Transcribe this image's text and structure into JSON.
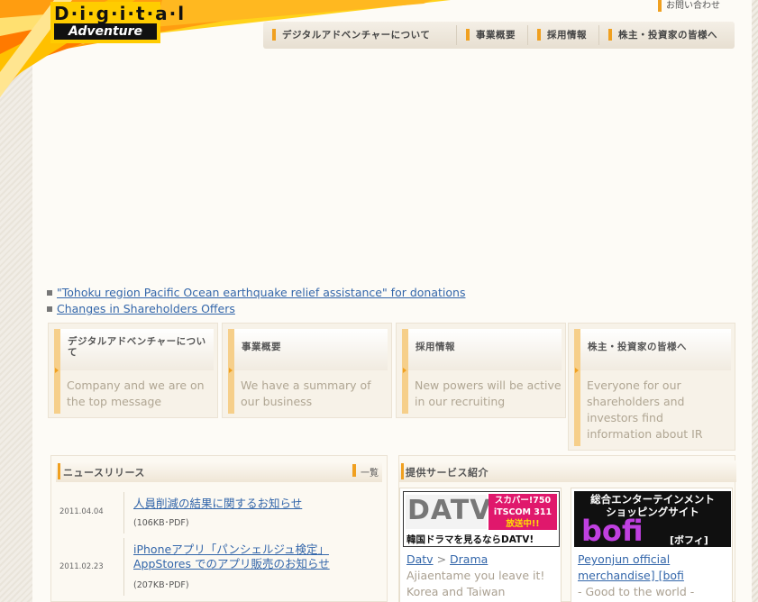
{
  "header": {
    "logo_line1": "D·i·g·i·t·a·l",
    "logo_line2": "Adventure",
    "contact_label": "お問い合わせ",
    "nav": [
      {
        "label": "デジタルアドベンチャーについて"
      },
      {
        "label": "事業概要"
      },
      {
        "label": "採用情報"
      },
      {
        "label": "株主・投資家の皆様へ"
      }
    ]
  },
  "notices": [
    "\"Tohoku region Pacific Ocean earthquake relief assistance\" for donations",
    "Changes in Shareholders Offers"
  ],
  "cards": [
    {
      "title": "デジタルアドベンチャーについて",
      "body": "Company and we are on the top message"
    },
    {
      "title": "事業概要",
      "body": "We have a summary of our business"
    },
    {
      "title": "採用情報",
      "body": "New powers will be active in our recruiting"
    },
    {
      "title": "株主・投資家の皆様へ",
      "body": "Everyone for our shareholders and investors find information about IR"
    }
  ],
  "news": {
    "heading": "ニュースリリース",
    "more_label": "一覧",
    "items": [
      {
        "date": "2011.04.04",
        "title": "人員削減の結果に関するお知らせ",
        "meta": "(106KB･PDF)"
      },
      {
        "date": "2011.02.23",
        "title": "iPhoneアプリ「パンシェルジュ検定」AppStores でのアプリ販売のお知らせ",
        "meta": "(207KB･PDF)"
      }
    ]
  },
  "services": {
    "heading": "提供サービス紹介",
    "items": [
      {
        "banner_logo": "DATV",
        "banner_badge_1": "スカパー!750",
        "banner_badge_2": "iTSCOM 311",
        "banner_badge_3": "放送中!!",
        "banner_caption": "韓国ドラマを見るならDATV!",
        "link_1": "Datv",
        "link_sep": ">",
        "link_2": "Drama",
        "desc": "Ajiaentame you leave it! Korea and Taiwan"
      },
      {
        "banner_line1": "総合エンターテインメント",
        "banner_line2": "ショッピングサイト",
        "banner_logo": "bofi",
        "banner_kana": "[ボフィ]",
        "link": "Peyonjun official merchandise] [bofi",
        "desc": "- Good to the world -"
      }
    ]
  },
  "colors": {
    "accent": "#f0a020",
    "link": "#3366aa",
    "datv_pink": "#e0186c",
    "bofi_purple": "#c040e0"
  }
}
